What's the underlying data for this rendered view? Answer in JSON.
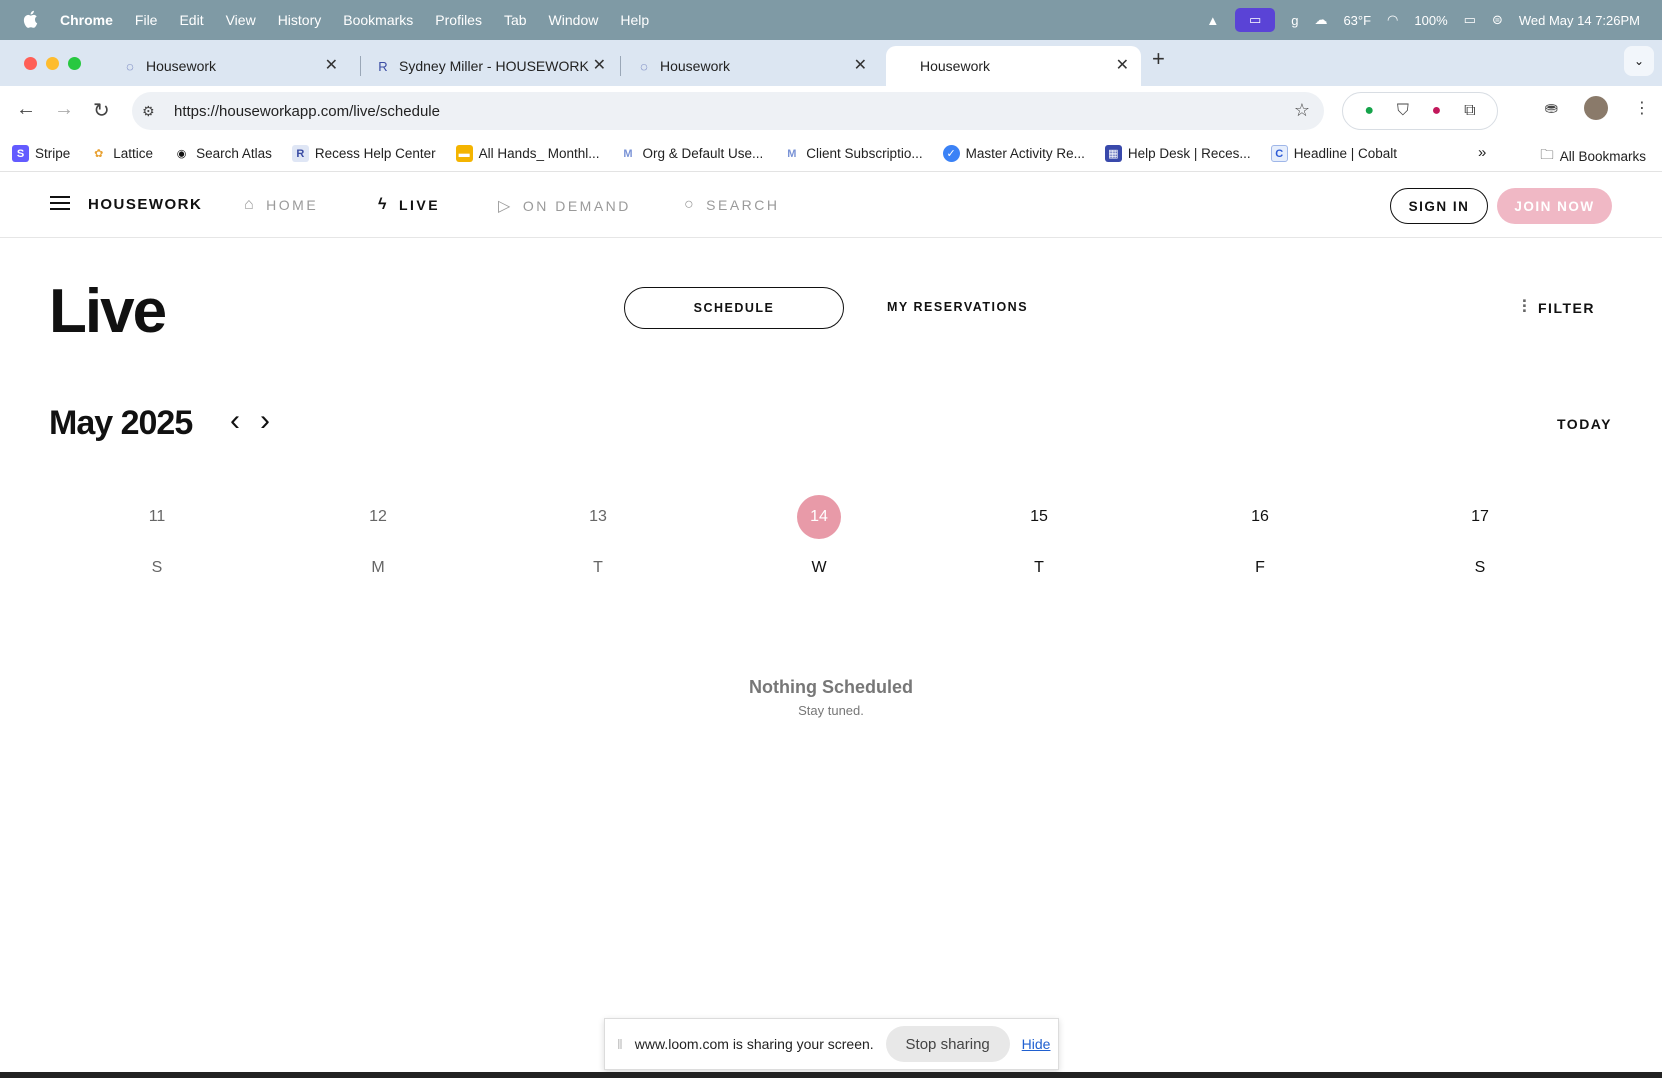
{
  "menubar": {
    "apple": "",
    "items": [
      "Chrome",
      "File",
      "Edit",
      "View",
      "History",
      "Bookmarks",
      "Profiles",
      "Tab",
      "Window",
      "Help"
    ],
    "weather": "63°F",
    "battery": "100%",
    "datetime": "Wed May 14  7:26PM"
  },
  "tabs": [
    {
      "title": "Housework",
      "favicon": "housework-icon"
    },
    {
      "title": "Sydney Miller - HOUSEWORK",
      "favicon": "R"
    },
    {
      "title": "Housework",
      "favicon": "housework-icon"
    },
    {
      "title": "Housework",
      "favicon": "",
      "active": true
    }
  ],
  "toolbar": {
    "url": "https://houseworkapp.com/live/schedule"
  },
  "bookmarks": [
    {
      "label": "Stripe",
      "icon": "S",
      "color": "#635bff"
    },
    {
      "label": "Lattice",
      "icon": "✿",
      "color": "#e8a030"
    },
    {
      "label": "Search Atlas",
      "icon": "◉",
      "color": "#111111"
    },
    {
      "label": "Recess Help Center",
      "icon": "R",
      "color": "#dfe6f5"
    },
    {
      "label": "All Hands_ Monthl...",
      "icon": "▬",
      "color": "#f4b400"
    },
    {
      "label": "Org & Default Use...",
      "icon": "M",
      "color": "#c6d4f0"
    },
    {
      "label": "Client Subscriptio...",
      "icon": "M",
      "color": "#c6d4f0"
    },
    {
      "label": "Master Activity Re...",
      "icon": "✓",
      "color": "#3b82f6"
    },
    {
      "label": "Help Desk | Reces...",
      "icon": "▦",
      "color": "#3949ab"
    },
    {
      "label": "Headline | Cobalt",
      "icon": "C",
      "color": "#e6eefc"
    }
  ],
  "bookmarks_more": "»",
  "bookmarks_all": "All Bookmarks",
  "site": {
    "logo": "HOUSEWORK",
    "nav": {
      "home": "HOME",
      "live": "LIVE",
      "on_demand": "ON DEMAND",
      "search": "SEARCH"
    },
    "sign_in": "SIGN IN",
    "join_now": "JOIN NOW"
  },
  "page": {
    "title": "Live",
    "tab_schedule": "SCHEDULE",
    "tab_reservations": "MY RESERVATIONS",
    "filter": "FILTER",
    "month": "May 2025",
    "today": "TODAY",
    "days": [
      {
        "date": "11",
        "weekday": "S",
        "state": "past"
      },
      {
        "date": "12",
        "weekday": "M",
        "state": "past"
      },
      {
        "date": "13",
        "weekday": "T",
        "state": "past"
      },
      {
        "date": "14",
        "weekday": "W",
        "state": "today"
      },
      {
        "date": "15",
        "weekday": "T",
        "state": "future"
      },
      {
        "date": "16",
        "weekday": "F",
        "state": "future"
      },
      {
        "date": "17",
        "weekday": "S",
        "state": "future"
      }
    ],
    "empty_title": "Nothing Scheduled",
    "empty_subtitle": "Stay tuned."
  },
  "sharebar": {
    "message": "www.loom.com is sharing your screen.",
    "stop": "Stop sharing",
    "hide": "Hide"
  },
  "colors": {
    "accent_pink": "#e89aa8",
    "join_button": "#f0b8c5",
    "menubar_bg": "#7f9aa5",
    "tabstrip_bg": "#dce6f2"
  }
}
